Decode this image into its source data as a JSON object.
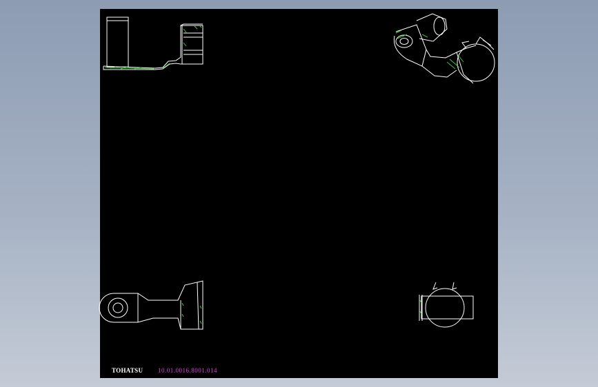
{
  "title_block": {
    "brand": "TOHATSU",
    "drawing_number": "10.01.0016.8001.014"
  },
  "colors": {
    "background": "#97a5ba",
    "sheet": "#000000",
    "outline": "#ffffff",
    "hatch": "#3cc43c",
    "drawing_number": "#e040e0"
  },
  "views": [
    "side-view",
    "isometric-view",
    "top-view",
    "end-view"
  ]
}
